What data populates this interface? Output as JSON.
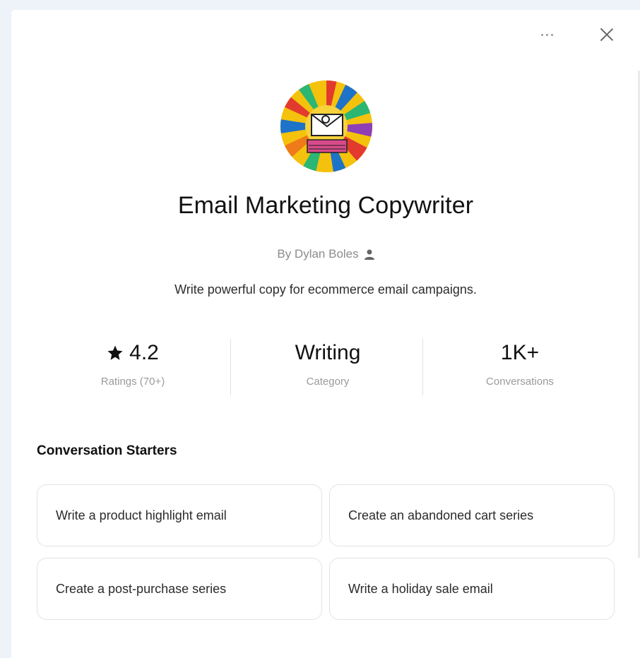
{
  "gpt": {
    "title": "Email Marketing Copywriter",
    "author": "By Dylan Boles",
    "description": "Write powerful copy for ecommerce email campaigns."
  },
  "stats": [
    {
      "value": "4.2",
      "label": "Ratings (70+)",
      "icon": "star-icon"
    },
    {
      "value": "Writing",
      "label": "Category"
    },
    {
      "value": "1K+",
      "label": "Conversations"
    }
  ],
  "starters": {
    "title": "Conversation Starters",
    "items": [
      "Write a product highlight email",
      "Create an abandoned cart series",
      "Create a post-purchase series",
      "Write a holiday sale email"
    ]
  },
  "icons": {
    "more": "more-dots-icon",
    "close": "close-icon",
    "user": "user-icon"
  },
  "colors": {
    "background": "#eef3f9",
    "panel": "#ffffff",
    "muted_text": "#8c8c8c",
    "card_border": "#e3e3e3"
  }
}
